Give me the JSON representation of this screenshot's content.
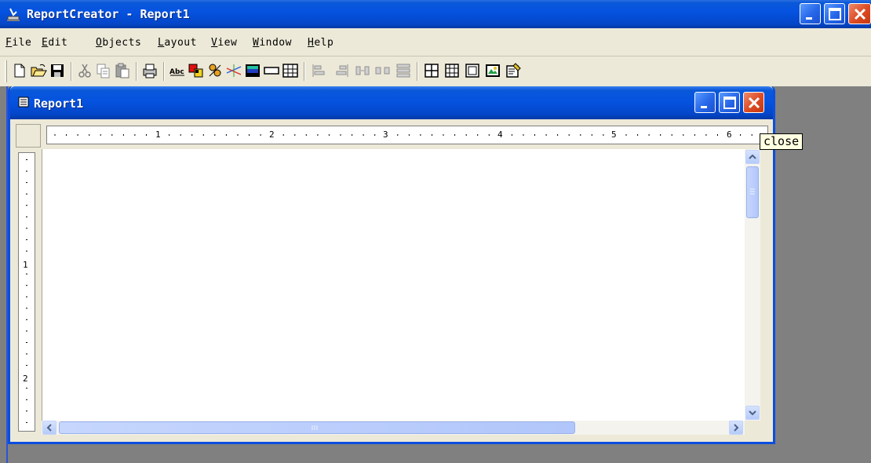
{
  "app": {
    "title": "ReportCreator - Report1"
  },
  "menu": [
    {
      "pre": "",
      "accel": "F",
      "post": "ile"
    },
    {
      "pre": "",
      "accel": "E",
      "post": "dit"
    },
    {
      "pre": "",
      "accel": "O",
      "post": "bjects"
    },
    {
      "pre": "",
      "accel": "L",
      "post": "ayout"
    },
    {
      "pre": "",
      "accel": "V",
      "post": "iew"
    },
    {
      "pre": "",
      "accel": "W",
      "post": "indow"
    },
    {
      "pre": "",
      "accel": "H",
      "post": "elp"
    }
  ],
  "toolbar": {
    "buttons": [
      "new-icon",
      "open-icon",
      "save-icon",
      "cut-icon",
      "copy-icon",
      "paste-icon",
      "print-icon",
      "text-label-icon",
      "insert-field-icon",
      "group-icon",
      "line-icon",
      "image-icon",
      "rectangle-icon",
      "table-icon",
      "align-left-icon",
      "align-right-icon",
      "space-horizontal-icon",
      "space-vertical-icon",
      "distribute-icon",
      "grid-1-icon",
      "grid-2-icon",
      "frame-icon",
      "picture-icon",
      "properties-icon"
    ]
  },
  "child": {
    "title": "Report1"
  },
  "ruler": {
    "horizontal": [
      "1",
      "2",
      "3",
      "4",
      "5",
      "6"
    ],
    "vertical": [
      "1",
      "2"
    ]
  },
  "tooltip": {
    "text": "close"
  },
  "colors": {
    "titlebar": "#0553e0",
    "close": "#dc4a22",
    "workspace": "#808080",
    "tooltip_bg": "#ffffe1"
  }
}
